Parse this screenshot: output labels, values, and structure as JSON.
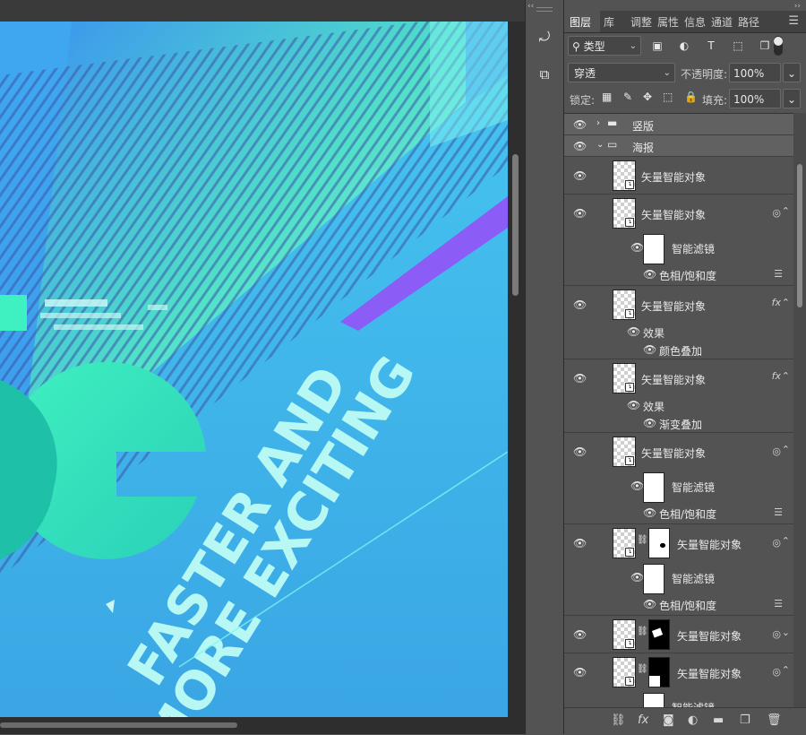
{
  "panel_tabs": [
    "图层",
    "库",
    "调整",
    "属性",
    "信息",
    "通道",
    "路径"
  ],
  "filter": {
    "label": "类型"
  },
  "blend_mode": "穿透",
  "opacity": {
    "label": "不透明度:",
    "value": "100%"
  },
  "lock": {
    "label": "锁定:"
  },
  "fill": {
    "label": "填充:",
    "value": "100%"
  },
  "layers": {
    "group_vertical": "竖版",
    "group_poster": "海报",
    "vso": "矢量智能对象",
    "smart_filter": "智能滤镜",
    "hue_sat": "色相/饱和度",
    "effects": "效果",
    "color_overlay": "颜色叠加",
    "gradient_overlay": "渐变叠加",
    "fx": "fx"
  },
  "canvas": {
    "line1": "FASTER AND",
    "line2": "MORE EXCITING",
    "colors": {
      "bg_top": "#3fb8ee",
      "bg_bottom": "#3ea8e6",
      "accent_green": "#3ff0c0",
      "accent_purple": "#8b5cf6",
      "text": "#b8f8f4"
    }
  },
  "collapse_glyph": "‹‹",
  "collapse_glyph_right": "››"
}
